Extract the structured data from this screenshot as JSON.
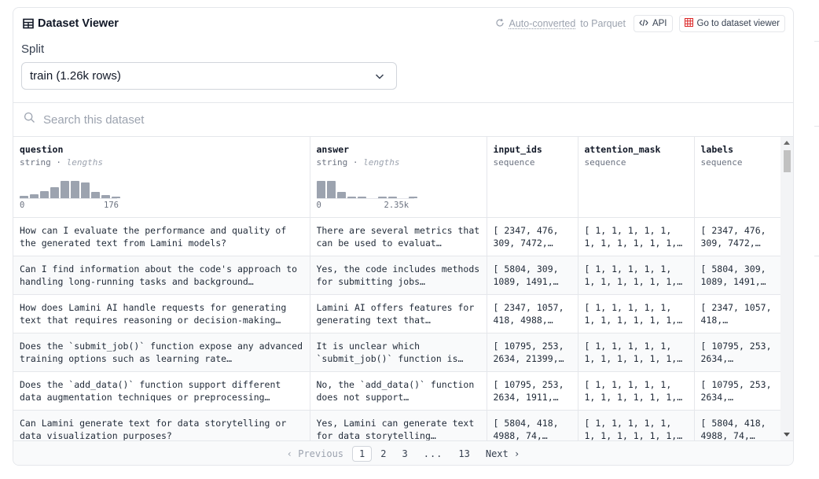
{
  "header": {
    "title": "Dataset Viewer",
    "converted_link": "Auto-converted",
    "converted_suffix": "to Parquet",
    "api_label": "API",
    "go_label": "Go to dataset viewer"
  },
  "split": {
    "label": "Split",
    "value": "train (1.26k rows)"
  },
  "search": {
    "placeholder": "Search this dataset"
  },
  "columns": [
    {
      "name": "question",
      "type": "string",
      "sub": "lengths",
      "hist_min": "0",
      "hist_max": "176",
      "histogram": [
        0.1,
        0.2,
        0.35,
        0.55,
        0.85,
        0.85,
        0.75,
        0.3,
        0.15,
        0.05
      ]
    },
    {
      "name": "answer",
      "type": "string",
      "sub": "lengths",
      "hist_min": "0",
      "hist_max": "2.35k",
      "histogram": [
        0.85,
        0.85,
        0.3,
        0.05,
        0.05,
        0,
        0.05,
        0.05,
        0,
        0.05
      ]
    },
    {
      "name": "input_ids",
      "type": "sequence"
    },
    {
      "name": "attention_mask",
      "type": "sequence"
    },
    {
      "name": "labels",
      "type": "sequence"
    }
  ],
  "rows": [
    [
      "How can I evaluate the performance and quality of the generated text from Lamini models?",
      "There are several metrics that can be used to evaluat…",
      "[ 2347, 476, 309, 7472,…",
      "[ 1, 1, 1, 1, 1, 1, 1, 1, 1, 1, 1,…",
      "[ 2347, 476, 309, 7472,…"
    ],
    [
      "Can I find information about the code's approach to handling long-running tasks and background…",
      "Yes, the code includes methods for submitting jobs…",
      "[ 5804, 309, 1089, 1491,…",
      "[ 1, 1, 1, 1, 1, 1, 1, 1, 1, 1, 1,…",
      "[ 5804, 309, 1089, 1491,…"
    ],
    [
      "How does Lamini AI handle requests for generating text that requires reasoning or decision-making…",
      "Lamini AI offers features for generating text that…",
      "[ 2347, 1057, 418, 4988,…",
      "[ 1, 1, 1, 1, 1, 1, 1, 1, 1, 1, 1,…",
      "[ 2347, 1057, 418,…"
    ],
    [
      "Does the `submit_job()` function expose any advanced training options such as learning rate…",
      "It is unclear which `submit_job()` function is…",
      "[ 10795, 253, 2634, 21399,…",
      "[ 1, 1, 1, 1, 1, 1, 1, 1, 1, 1, 1,…",
      "[ 10795, 253, 2634,…"
    ],
    [
      "Does the `add_data()` function support different data augmentation techniques or preprocessing…",
      "No, the `add_data()` function does not support…",
      "[ 10795, 253, 2634, 1911,…",
      "[ 1, 1, 1, 1, 1, 1, 1, 1, 1, 1, 1,…",
      "[ 10795, 253, 2634,…"
    ],
    [
      "Can Lamini generate text for data storytelling or data visualization purposes?",
      "Yes, Lamini can generate text for data storytelling…",
      "[ 5804, 418, 4988, 74,…",
      "[ 1, 1, 1, 1, 1, 1, 1, 1, 1, 1, 1,…",
      "[ 5804, 418, 4988, 74,…"
    ]
  ],
  "pager": {
    "prev": "‹ Previous",
    "pages": [
      "1",
      "2",
      "3",
      "...",
      "13"
    ],
    "next": "Next ›"
  }
}
